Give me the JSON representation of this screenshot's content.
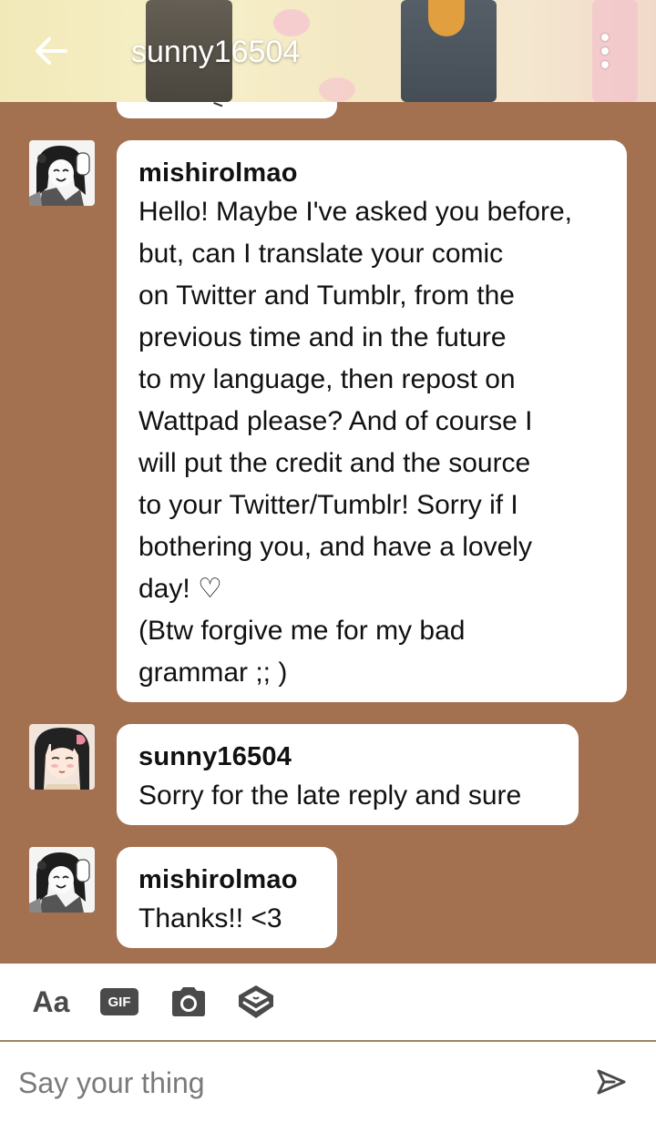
{
  "header": {
    "title": "sunny16504",
    "back_icon": "arrow-left-icon",
    "more_icon": "more-vertical-icon"
  },
  "messages": [
    {
      "author": "mishirolmao",
      "avatar": "manga-girl-avatar",
      "text": "Hello! Maybe I've asked you before,\nbut, can I translate your comic\non Twitter and Tumblr, from the\nprevious time and in the future\nto my language, then repost on\nWattpad please? And of course I\nwill put the credit and the source\nto your Twitter/Tumblr! Sorry if I\nbothering you, and have a lovely\nday! ♡\n(Btw forgive me for my bad\ngrammar ;; )"
    },
    {
      "author": "sunny16504",
      "avatar": "anime-girl-avatar",
      "text": "Sorry for the late reply and sure"
    },
    {
      "author": "mishirolmao",
      "avatar": "manga-girl-avatar",
      "text": "Thanks!! <3"
    }
  ],
  "composer": {
    "text_format_label": "Aa",
    "gif_label": "GIF",
    "camera_icon": "camera-icon",
    "sticker_icon": "sticker-icon",
    "placeholder": "Say your thing",
    "send_icon": "send-icon"
  },
  "colors": {
    "chat_background": "#a37050",
    "bubble": "#ffffff",
    "icon": "#4a4a4a"
  }
}
